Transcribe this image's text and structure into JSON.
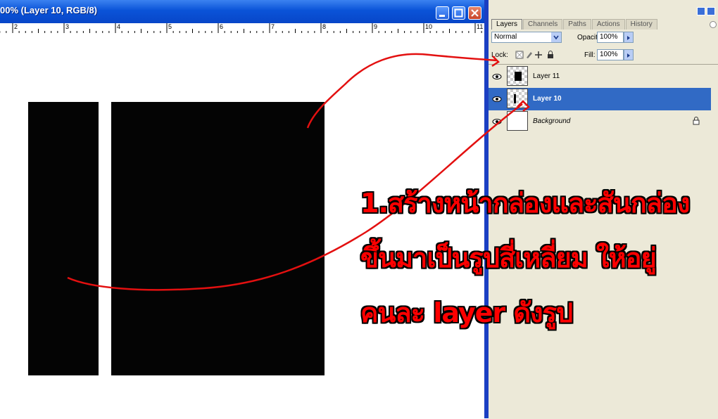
{
  "document": {
    "title": "00% (Layer 10, RGB/8)",
    "ruler_numbers": [
      "2",
      "3",
      "4",
      "5",
      "6",
      "7",
      "8",
      "9",
      "10",
      "11"
    ]
  },
  "palette": {
    "tabs": [
      "Layers",
      "Channels",
      "Paths",
      "Actions",
      "History"
    ],
    "active_tab": "Layers",
    "blend_mode": "Normal",
    "opacity_label": "Opacity:",
    "opacity_value": "100%",
    "lock_label": "Lock:",
    "fill_label": "Fill:",
    "fill_value": "100%",
    "layers": [
      {
        "name": "Layer 11",
        "selected": false,
        "visible": true
      },
      {
        "name": "Layer 10",
        "selected": true,
        "visible": true
      },
      {
        "name": "Background",
        "selected": false,
        "visible": true,
        "locked": true
      }
    ]
  },
  "annotation": {
    "lines": [
      "1.สร้างหน้ากล่องและสันกล่อง",
      "ขึ้นมาเป็นรูปสี่เหลี่ยม ให้อยู่",
      "คนละ layer ดังรูป"
    ],
    "color": "#ff0000"
  },
  "colors": {
    "titlebar": "#0a53d8",
    "selected_layer": "#316ac5",
    "palette_bg": "#ece9d8",
    "shape_fill": "#040404"
  }
}
